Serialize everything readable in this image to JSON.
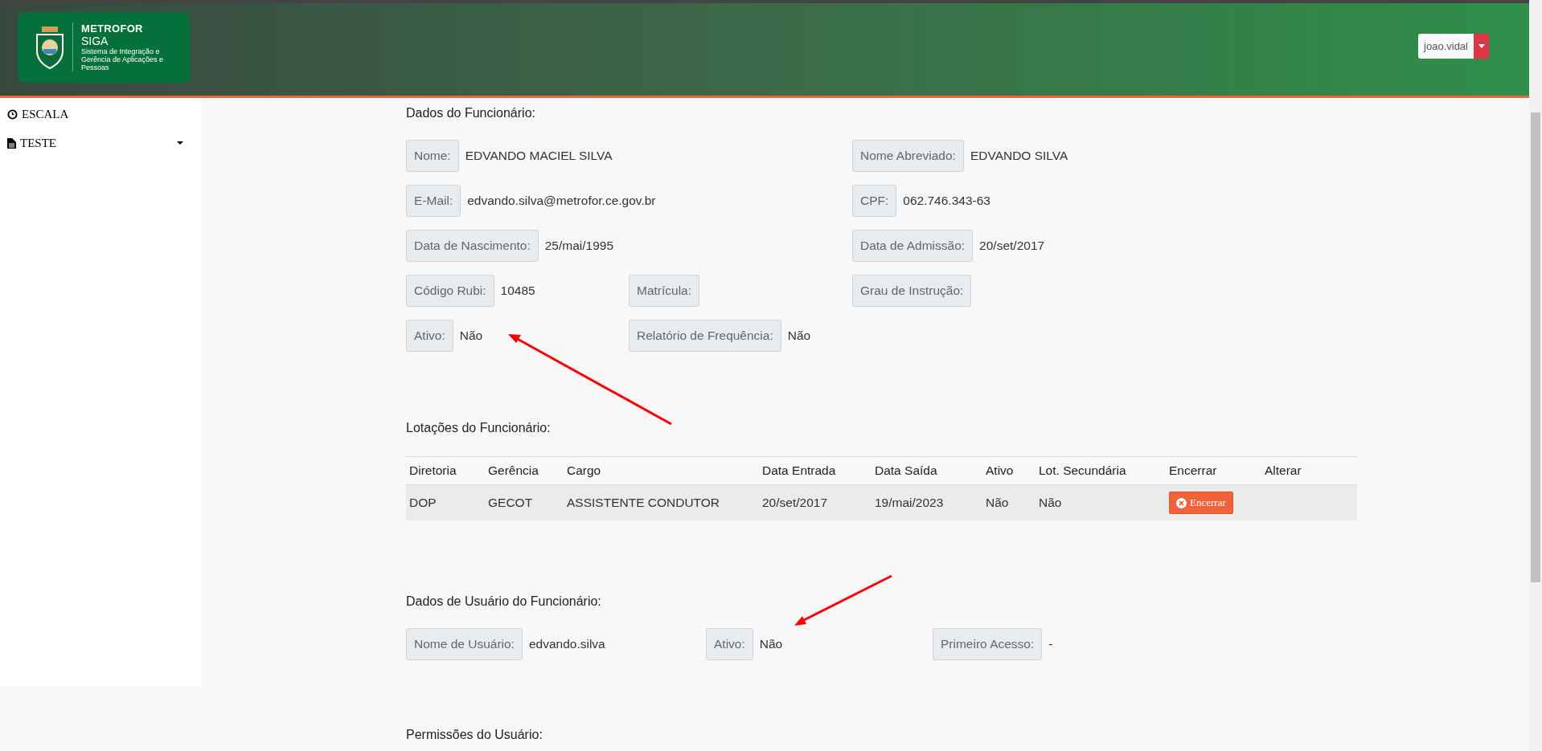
{
  "header": {
    "logo": {
      "title": "METROFOR",
      "subtitle": "SIGA",
      "tagline": "Sistema de Integração e Gerência de Aplicações e Pessoas"
    },
    "user_menu": {
      "label": "joao.vidal"
    }
  },
  "sidebar": {
    "items": [
      {
        "label": "ESCALA",
        "kind": "link"
      },
      {
        "label": "TESTE",
        "kind": "submenu"
      }
    ]
  },
  "employee": {
    "title": "Dados do Funcionário:",
    "rows": [
      {
        "kind": "pair",
        "fields": [
          {
            "label": "Nome:",
            "value": "EDVANDO MACIEL SILVA"
          },
          {
            "label": "Nome Abreviado:",
            "value": "EDVANDO SILVA"
          }
        ]
      },
      {
        "kind": "pair",
        "fields": [
          {
            "label": "E-Mail:",
            "value": "edvando.silva@metrofor.ce.gov.br"
          },
          {
            "label": "CPF:",
            "value": "062.746.343-63"
          }
        ]
      },
      {
        "kind": "pair",
        "fields": [
          {
            "label": "Data de Nascimento:",
            "value": "25/mai/1995"
          },
          {
            "label": "Data de Admissão:",
            "value": "20/set/2017"
          }
        ]
      },
      {
        "kind": "triple",
        "fields": [
          {
            "label": "Código Rubi:",
            "value": "10485"
          },
          {
            "label": "Matrícula:"
          },
          {
            "label": "Grau de Instrução:"
          }
        ]
      },
      {
        "kind": "triple",
        "fields": [
          {
            "label": "Ativo:",
            "value": "Não"
          },
          {
            "label": "Relatório de Frequência:",
            "value": "Não"
          }
        ]
      }
    ]
  },
  "assignments": {
    "title": "Lotações do Funcionário:",
    "columns": [
      "Diretoria",
      "Gerência",
      "Cargo",
      "Data Entrada",
      "Data Saída",
      "Ativo",
      "Lot. Secundária",
      "Encerrar",
      "Alterar"
    ],
    "rows": [
      {
        "cells": [
          "DOP",
          "GECOT",
          "ASSISTENTE CONDUTOR",
          "20/set/2017",
          "19/mai/2023",
          "Não",
          "Não"
        ],
        "action": "Encerrar"
      }
    ]
  },
  "user": {
    "title": "Dados de Usuário do Funcionário:",
    "fields": [
      {
        "label": "Nome de Usuário:",
        "value": "edvando.silva"
      },
      {
        "label": "Ativo:",
        "value": "Não"
      },
      {
        "label": "Primeiro Acesso:",
        "value": "-"
      }
    ]
  },
  "permissions": {
    "title": "Permissões do Usuário:"
  }
}
